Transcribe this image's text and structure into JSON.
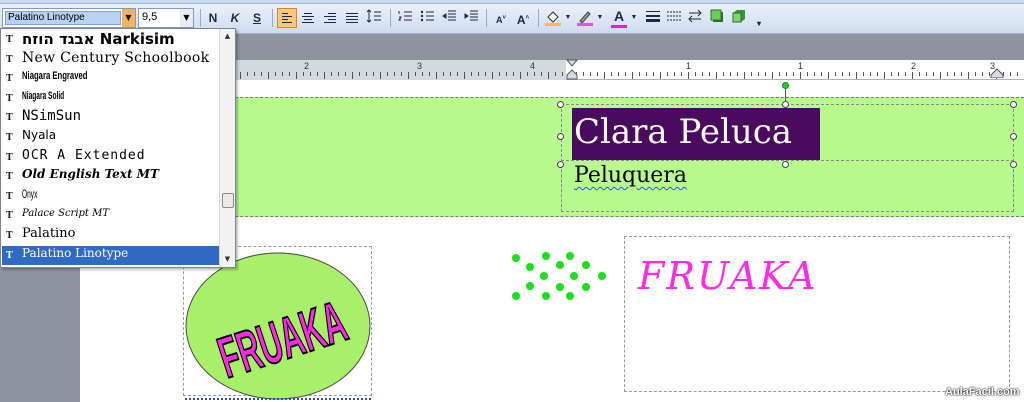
{
  "toolbar": {
    "font_value": "Palatino Linotype",
    "size_value": "9,5",
    "bold_label": "N",
    "italic_label": "K",
    "underline_label": "S",
    "grow_font_label": "A",
    "shrink_font_label": "A",
    "font_color_label": "A"
  },
  "font_list": {
    "items": [
      {
        "label": "אבגד הוזח Narkisim",
        "font": "DejaVu Sans"
      },
      {
        "label": "New Century Schoolbook",
        "font": "DejaVu Serif"
      },
      {
        "label": "Niagara Engraved",
        "font": "Liberation Sans Narrow"
      },
      {
        "label": "Niagara Solid",
        "font": "Liberation Sans Narrow"
      },
      {
        "label": "NSimSun",
        "font": "DejaVu Sans Mono"
      },
      {
        "label": "Nyala",
        "font": "DejaVu Sans"
      },
      {
        "label": "OCR A Extended",
        "font": "DejaVu Sans Mono"
      },
      {
        "label": "Old English Text MT",
        "font": "DejaVu Serif"
      },
      {
        "label": "Onyx",
        "font": "Liberation Sans Narrow"
      },
      {
        "label": "Palace Script MT",
        "font": "DejaVu Serif"
      },
      {
        "label": "Palatino",
        "font": "DejaVu Serif"
      },
      {
        "label": "Palatino Linotype",
        "font": "DejaVu Serif"
      }
    ],
    "selected_index": 11
  },
  "ruler": {
    "labels": [
      "2",
      "3",
      "4",
      "1",
      "1",
      "2",
      "3"
    ]
  },
  "document": {
    "name": "Clara Peluca",
    "role": "Peluquera",
    "logo_text": "FRUAKA",
    "oval_text": "FRUAKA"
  },
  "watermark": "AulaFacil.com",
  "colors": {
    "band_green": "#b7fb8f",
    "name_box": "#4a0a5e",
    "logo_pink": "#ff29e8",
    "oval_green": "#a8f06a",
    "arrows_green": "#19e019"
  }
}
